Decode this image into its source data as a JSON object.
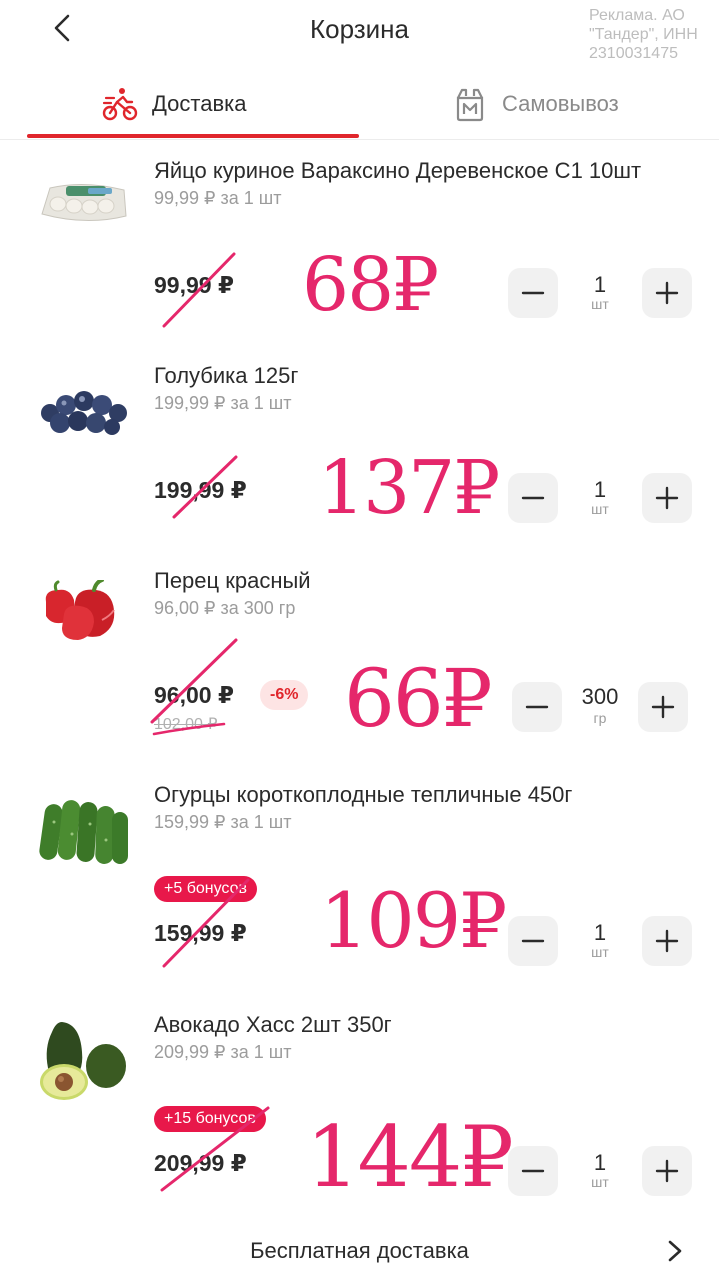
{
  "header": {
    "title": "Корзина",
    "ad_text": "Реклама. АО \"Тандер\", ИНН 2310031475",
    "back_icon": "chevron-left-icon"
  },
  "tabs": [
    {
      "label": "Доставка",
      "icon": "courier-bike-icon",
      "active": true
    },
    {
      "label": "Самовывоз",
      "icon": "shopping-bag-icon",
      "active": false
    }
  ],
  "items": [
    {
      "name": "Яйцо куриное Вараксино Деревенское С1 10шт",
      "unit_price": "99,99 ₽ за 1 шт",
      "price": "99,99 ₽",
      "handwritten_price": "68₽",
      "quantity": "1",
      "quantity_unit": "шт"
    },
    {
      "name": "Голубика 125г",
      "unit_price": "199,99 ₽ за 1 шт",
      "price": "199,99 ₽",
      "handwritten_price": "137₽",
      "quantity": "1",
      "quantity_unit": "шт"
    },
    {
      "name": "Перец красный",
      "unit_price": "96,00 ₽ за 300 гр",
      "price": "96,00 ₽",
      "old_price": "102,00 ₽",
      "discount": "-6%",
      "handwritten_price": "66₽",
      "quantity": "300",
      "quantity_unit": "гр"
    },
    {
      "name": "Огурцы короткоплодные тепличные 450г",
      "unit_price": "159,99 ₽ за 1 шт",
      "bonus": "+5 бонусов",
      "price": "159,99 ₽",
      "handwritten_price": "109₽",
      "quantity": "1",
      "quantity_unit": "шт"
    },
    {
      "name": "Авокадо Хасс 2шт 350г",
      "unit_price": "209,99 ₽ за 1 шт",
      "bonus": "+15 бонусов",
      "price": "209,99 ₽",
      "handwritten_price": "144₽",
      "quantity": "1",
      "quantity_unit": "шт"
    }
  ],
  "footer": {
    "label": "Бесплатная доставка",
    "icon": "chevron-right-icon"
  },
  "colors": {
    "accent": "#e0262c",
    "handwriting": "#e5276b",
    "bonus_badge": "#e8184a",
    "stepper_bg": "#f1f1f1"
  }
}
